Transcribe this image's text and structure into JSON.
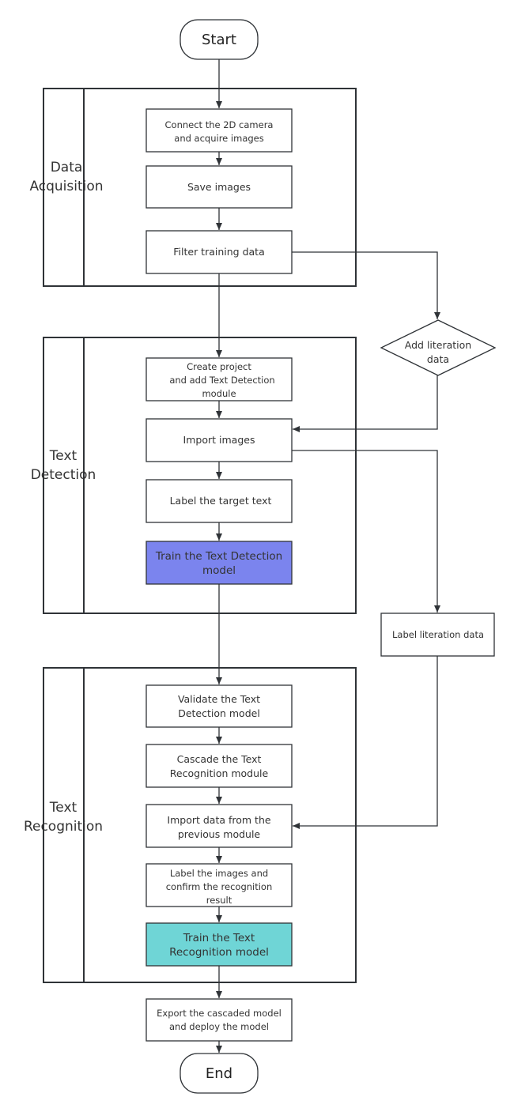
{
  "terminals": {
    "start": "Start",
    "end": "End"
  },
  "lanes": {
    "data_acquisition": [
      "Data",
      "Acquisition"
    ],
    "text_detection": [
      "Text",
      "Detection"
    ],
    "text_recognition": [
      "Text",
      "Recognition"
    ]
  },
  "steps": {
    "connect_camera": [
      "Connect the 2D camera",
      "and acquire images"
    ],
    "save_images": [
      "Save images"
    ],
    "filter_data": [
      "Filter training data"
    ],
    "create_project": [
      "Create project",
      "and add Text Detection",
      "module"
    ],
    "import_images": [
      "Import images"
    ],
    "label_target": [
      "Label the target text"
    ],
    "train_detection": [
      "Train the Text Detection",
      "model"
    ],
    "validate_detection": [
      "Validate the Text",
      "Detection model"
    ],
    "cascade_recognition": [
      "Cascade the Text",
      "Recognition module"
    ],
    "import_previous": [
      "Import data from the",
      "previous module"
    ],
    "label_confirm": [
      "Label the images and",
      "confirm the recognition",
      "result"
    ],
    "train_recognition": [
      "Train the Text",
      "Recognition model"
    ],
    "export_deploy": [
      "Export the cascaded model",
      "and deploy the model"
    ],
    "add_literation": [
      "Add literation",
      "data"
    ],
    "label_literation": [
      "Label literation data"
    ]
  },
  "colors": {
    "train_detection": "#7b84ee",
    "train_recognition": "#6fd5d6",
    "stroke": "#2f3337"
  }
}
